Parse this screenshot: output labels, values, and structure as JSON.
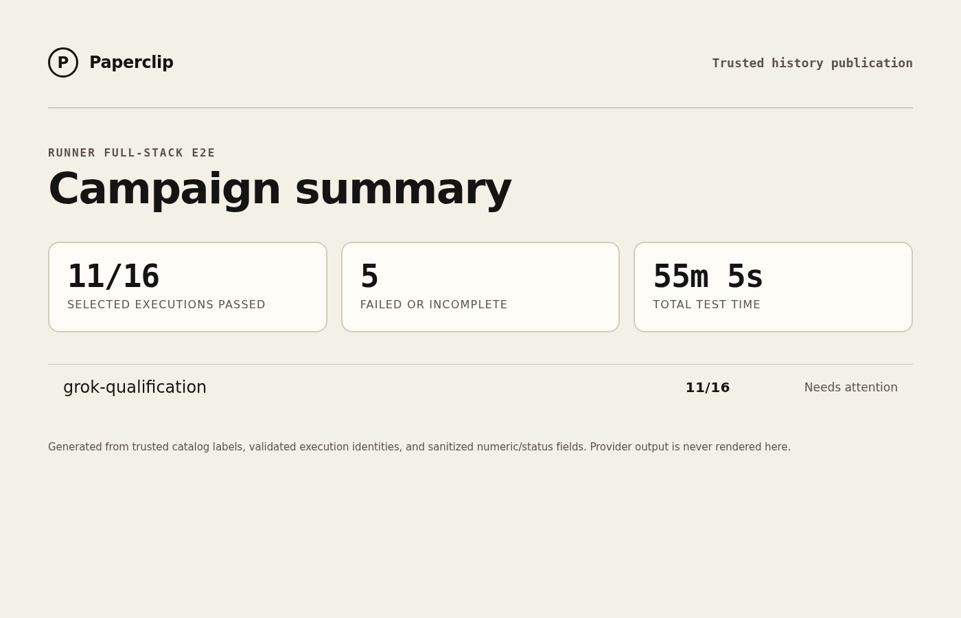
{
  "header": {
    "logo_letter": "P",
    "brand": "Paperclip",
    "tagline": "Trusted history publication"
  },
  "eyebrow": "RUNNER FULL-STACK E2E",
  "title": "Campaign summary",
  "metrics": [
    {
      "value": "11/16",
      "label": "SELECTED EXECUTIONS PASSED"
    },
    {
      "value": "5",
      "label": "FAILED OR INCOMPLETE"
    },
    {
      "value": "55m 5s",
      "label": "TOTAL TEST TIME"
    }
  ],
  "campaigns": [
    {
      "name": "grok-qualification",
      "passed": "11/16",
      "status": "Needs attention"
    }
  ],
  "footnote": "Generated from trusted catalog labels, validated execution identities, and sanitized numeric/status fields. Provider output is never rendered here."
}
